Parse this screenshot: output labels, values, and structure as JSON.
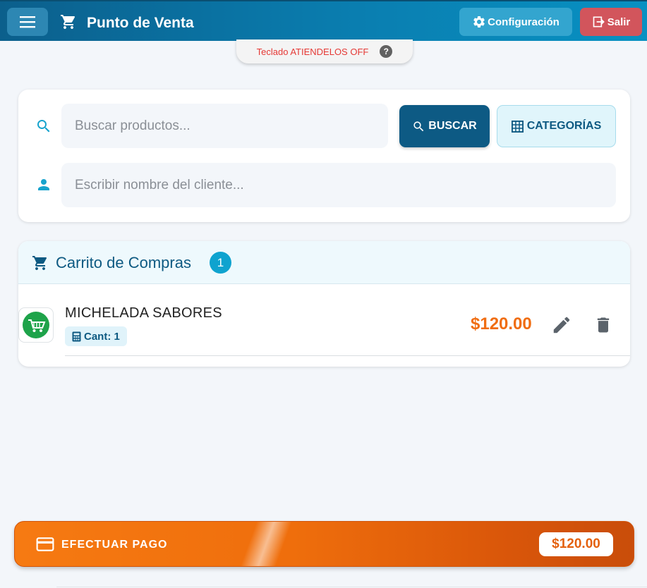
{
  "header": {
    "title": "Punto de Venta",
    "config_label": "Configuración",
    "exit_label": "Salir"
  },
  "keyboard_status": {
    "text": "Teclado ATIENDELOS OFF",
    "help_glyph": "?"
  },
  "search": {
    "products_placeholder": "Buscar productos...",
    "search_button_label": "BUSCAR",
    "categories_button_label": "CATEGORÍAS",
    "client_placeholder": "Escribir nombre del cliente..."
  },
  "cart": {
    "title": "Carrito de Compras",
    "count": "1",
    "items": [
      {
        "name": "MICHELADA SABORES",
        "qty_label": "Cant: 1",
        "price": "$120.00"
      }
    ]
  },
  "payment": {
    "label": "EFECTUAR PAGO",
    "total": "$120.00"
  },
  "colors": {
    "header_start": "#0b5f8c",
    "header_end": "#0891c2",
    "exit_button": "#d2555c",
    "price_orange": "#f06d12",
    "pay_bar_orange": "#ef6e0c"
  },
  "icons": {
    "menu": "menu-icon",
    "header_cart": "cart-icon",
    "config": "gear-icon",
    "exit": "exit-icon",
    "search": "search-icon",
    "categories": "grid-icon",
    "client": "person-icon",
    "item_image": "shopping-cart-logo",
    "qty": "calculator-icon",
    "edit": "pencil-icon",
    "delete": "trash-icon",
    "payment": "credit-card-icon"
  }
}
